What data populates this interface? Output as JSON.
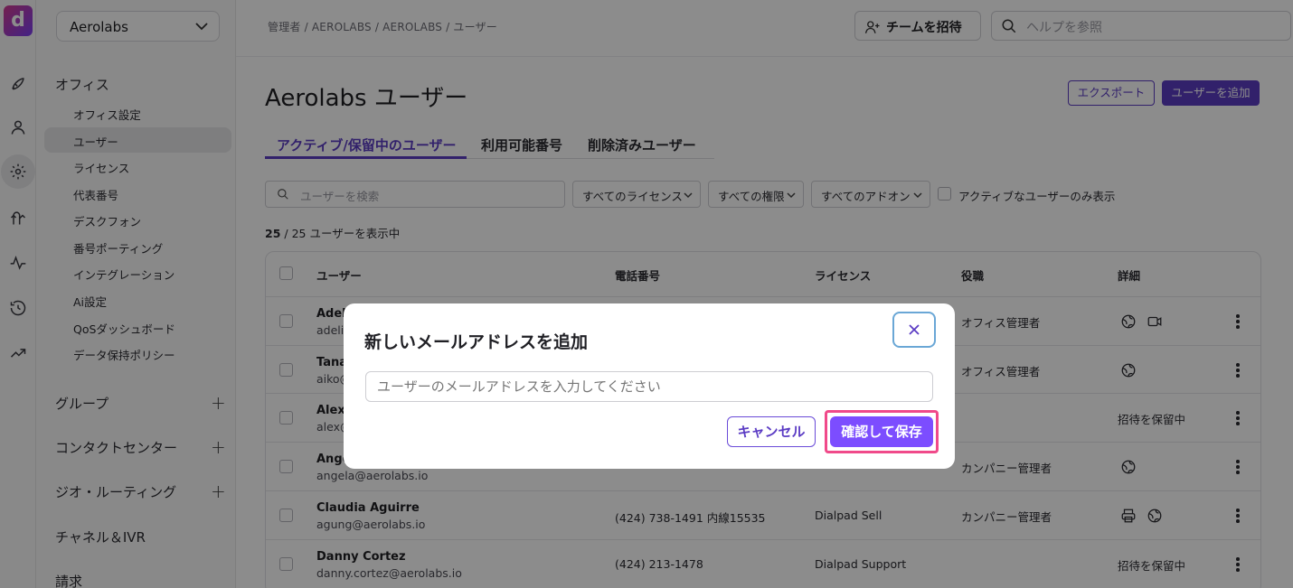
{
  "app": {
    "logo": "d",
    "accent_color": "#5b3cc4"
  },
  "rail": {
    "icons": [
      "rocket-icon",
      "person-icon",
      "gear-icon",
      "routing-icon",
      "activity-icon",
      "history-icon",
      "trending-icon"
    ]
  },
  "sidebar": {
    "org": "Aerolabs",
    "office_section": "オフィス",
    "items": [
      "オフィス設定",
      "ユーザー",
      "ライセンス",
      "代表番号",
      "デスクフォン",
      "番号ポーティング",
      "インテグレーション",
      "Ai設定",
      "QoSダッシュボード",
      "データ保持ポリシー"
    ],
    "active_item": "ユーザー",
    "sections": [
      "グループ",
      "コンタクトセンター",
      "ジオ・ルーティング",
      "チャネル＆IVR",
      "請求"
    ]
  },
  "header": {
    "breadcrumb": "管理者 / AEROLABS / AEROLABS / ユーザー",
    "invite_label": "チームを招待",
    "help_placeholder": "ヘルプを参照"
  },
  "main": {
    "title": "Aerolabs ユーザー",
    "export_label": "エクスポート",
    "add_user_label": "ユーザーを追加",
    "tabs": [
      "アクティブ/保留中のユーザー",
      "利用可能番号",
      "削除済みユーザー"
    ],
    "search_placeholder": "ユーザーを検索",
    "filters": [
      "すべてのライセンス",
      "すべての権限",
      "すべてのアドオン"
    ],
    "only_active_label": "アクティブなユーザーのみ表示",
    "count_shown": "25",
    "count_rest": " / 25 ユーザーを表示中"
  },
  "table": {
    "headers": [
      "ユーザー",
      "電話番号",
      "ライセンス",
      "役職",
      "詳細"
    ],
    "rows": [
      {
        "name": "Adeli",
        "email": "adeli",
        "phone": "",
        "license": "",
        "role": "オフィス管理者",
        "details": "",
        "icons": [
          "globe-icon",
          "video-icon"
        ]
      },
      {
        "name": "Tana",
        "email": "aiko@",
        "phone": "",
        "license": "",
        "role": "オフィス管理者",
        "details": "",
        "icons": [
          "globe-icon"
        ]
      },
      {
        "name": "Alex",
        "email": "alex@",
        "phone": "",
        "license": "",
        "role": "",
        "details": "招待を保留中",
        "icons": []
      },
      {
        "name": "Angel",
        "email": "angela@aerolabs.io",
        "phone": "",
        "license": "",
        "role": "カンパニー管理者",
        "details": "",
        "icons": [
          "globe-icon"
        ]
      },
      {
        "name": "Claudia Aguirre",
        "email": "agung@aerolabs.io",
        "phone": "(424) 738-1491 内線15535",
        "license": "Dialpad Sell",
        "role": "カンパニー管理者",
        "details": "",
        "icons": [
          "printer-icon",
          "globe-icon"
        ]
      },
      {
        "name": "Danny Cortez",
        "email": "danny.cortez@aerolabs.io",
        "phone": "(424) 213-1478",
        "license": "Dialpad Support",
        "role": "",
        "details": "招待を保留中",
        "icons": []
      }
    ]
  },
  "dialog": {
    "title": "新しいメールアドレスを追加",
    "email_placeholder": "ユーザーのメールアドレスを入力してください",
    "cancel_label": "キャンセル",
    "save_label": "確認して保存"
  }
}
